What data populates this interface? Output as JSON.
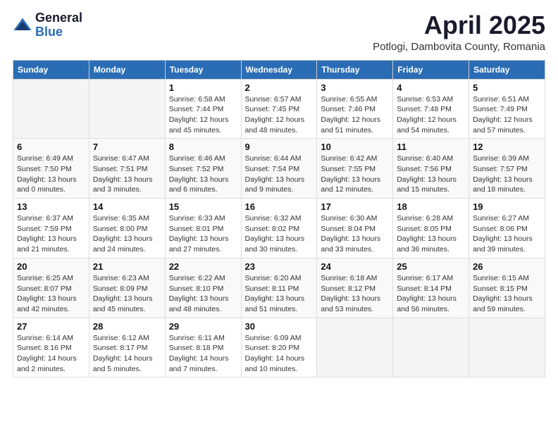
{
  "logo": {
    "general": "General",
    "blue": "Blue"
  },
  "header": {
    "title": "April 2025",
    "subtitle": "Potlogi, Dambovita County, Romania"
  },
  "days_of_week": [
    "Sunday",
    "Monday",
    "Tuesday",
    "Wednesday",
    "Thursday",
    "Friday",
    "Saturday"
  ],
  "weeks": [
    [
      {
        "day": "",
        "info": ""
      },
      {
        "day": "",
        "info": ""
      },
      {
        "day": "1",
        "info": "Sunrise: 6:58 AM\nSunset: 7:44 PM\nDaylight: 12 hours\nand 45 minutes."
      },
      {
        "day": "2",
        "info": "Sunrise: 6:57 AM\nSunset: 7:45 PM\nDaylight: 12 hours\nand 48 minutes."
      },
      {
        "day": "3",
        "info": "Sunrise: 6:55 AM\nSunset: 7:46 PM\nDaylight: 12 hours\nand 51 minutes."
      },
      {
        "day": "4",
        "info": "Sunrise: 6:53 AM\nSunset: 7:48 PM\nDaylight: 12 hours\nand 54 minutes."
      },
      {
        "day": "5",
        "info": "Sunrise: 6:51 AM\nSunset: 7:49 PM\nDaylight: 12 hours\nand 57 minutes."
      }
    ],
    [
      {
        "day": "6",
        "info": "Sunrise: 6:49 AM\nSunset: 7:50 PM\nDaylight: 13 hours\nand 0 minutes."
      },
      {
        "day": "7",
        "info": "Sunrise: 6:47 AM\nSunset: 7:51 PM\nDaylight: 13 hours\nand 3 minutes."
      },
      {
        "day": "8",
        "info": "Sunrise: 6:46 AM\nSunset: 7:52 PM\nDaylight: 13 hours\nand 6 minutes."
      },
      {
        "day": "9",
        "info": "Sunrise: 6:44 AM\nSunset: 7:54 PM\nDaylight: 13 hours\nand 9 minutes."
      },
      {
        "day": "10",
        "info": "Sunrise: 6:42 AM\nSunset: 7:55 PM\nDaylight: 13 hours\nand 12 minutes."
      },
      {
        "day": "11",
        "info": "Sunrise: 6:40 AM\nSunset: 7:56 PM\nDaylight: 13 hours\nand 15 minutes."
      },
      {
        "day": "12",
        "info": "Sunrise: 6:39 AM\nSunset: 7:57 PM\nDaylight: 13 hours\nand 18 minutes."
      }
    ],
    [
      {
        "day": "13",
        "info": "Sunrise: 6:37 AM\nSunset: 7:59 PM\nDaylight: 13 hours\nand 21 minutes."
      },
      {
        "day": "14",
        "info": "Sunrise: 6:35 AM\nSunset: 8:00 PM\nDaylight: 13 hours\nand 24 minutes."
      },
      {
        "day": "15",
        "info": "Sunrise: 6:33 AM\nSunset: 8:01 PM\nDaylight: 13 hours\nand 27 minutes."
      },
      {
        "day": "16",
        "info": "Sunrise: 6:32 AM\nSunset: 8:02 PM\nDaylight: 13 hours\nand 30 minutes."
      },
      {
        "day": "17",
        "info": "Sunrise: 6:30 AM\nSunset: 8:04 PM\nDaylight: 13 hours\nand 33 minutes."
      },
      {
        "day": "18",
        "info": "Sunrise: 6:28 AM\nSunset: 8:05 PM\nDaylight: 13 hours\nand 36 minutes."
      },
      {
        "day": "19",
        "info": "Sunrise: 6:27 AM\nSunset: 8:06 PM\nDaylight: 13 hours\nand 39 minutes."
      }
    ],
    [
      {
        "day": "20",
        "info": "Sunrise: 6:25 AM\nSunset: 8:07 PM\nDaylight: 13 hours\nand 42 minutes."
      },
      {
        "day": "21",
        "info": "Sunrise: 6:23 AM\nSunset: 8:09 PM\nDaylight: 13 hours\nand 45 minutes."
      },
      {
        "day": "22",
        "info": "Sunrise: 6:22 AM\nSunset: 8:10 PM\nDaylight: 13 hours\nand 48 minutes."
      },
      {
        "day": "23",
        "info": "Sunrise: 6:20 AM\nSunset: 8:11 PM\nDaylight: 13 hours\nand 51 minutes."
      },
      {
        "day": "24",
        "info": "Sunrise: 6:18 AM\nSunset: 8:12 PM\nDaylight: 13 hours\nand 53 minutes."
      },
      {
        "day": "25",
        "info": "Sunrise: 6:17 AM\nSunset: 8:14 PM\nDaylight: 13 hours\nand 56 minutes."
      },
      {
        "day": "26",
        "info": "Sunrise: 6:15 AM\nSunset: 8:15 PM\nDaylight: 13 hours\nand 59 minutes."
      }
    ],
    [
      {
        "day": "27",
        "info": "Sunrise: 6:14 AM\nSunset: 8:16 PM\nDaylight: 14 hours\nand 2 minutes."
      },
      {
        "day": "28",
        "info": "Sunrise: 6:12 AM\nSunset: 8:17 PM\nDaylight: 14 hours\nand 5 minutes."
      },
      {
        "day": "29",
        "info": "Sunrise: 6:11 AM\nSunset: 8:18 PM\nDaylight: 14 hours\nand 7 minutes."
      },
      {
        "day": "30",
        "info": "Sunrise: 6:09 AM\nSunset: 8:20 PM\nDaylight: 14 hours\nand 10 minutes."
      },
      {
        "day": "",
        "info": ""
      },
      {
        "day": "",
        "info": ""
      },
      {
        "day": "",
        "info": ""
      }
    ]
  ]
}
